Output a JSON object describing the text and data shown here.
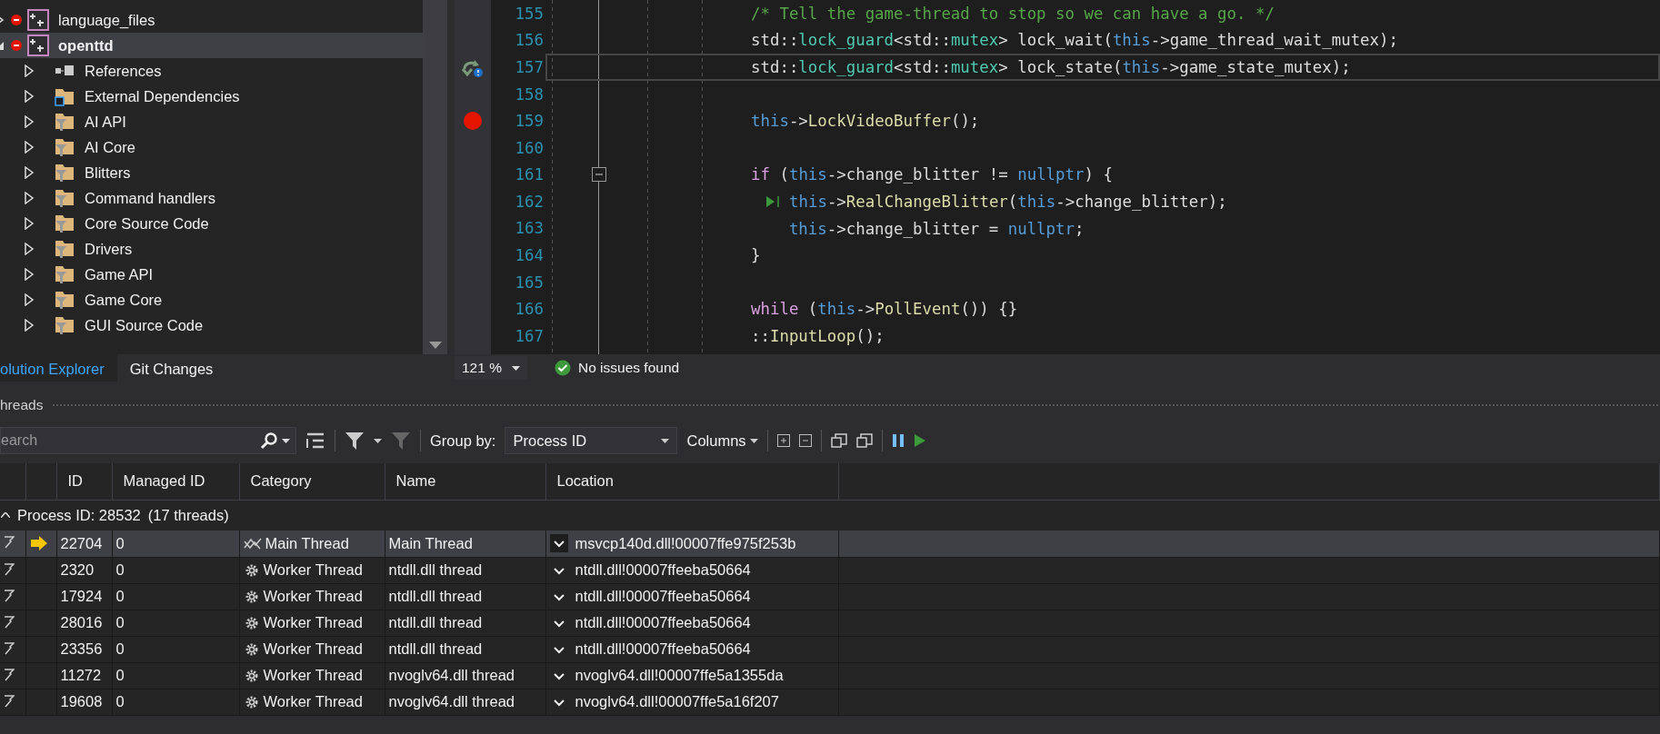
{
  "solution_explorer": {
    "tree": [
      {
        "label": "language_files",
        "kind": "project",
        "startup": false,
        "excluded": true,
        "expanded": false,
        "selected": false
      },
      {
        "label": "openttd",
        "kind": "project",
        "startup": true,
        "excluded": true,
        "expanded": true,
        "selected": true,
        "children": [
          {
            "label": "References",
            "kind": "references",
            "expanded": false,
            "selected": false
          },
          {
            "label": "External Dependencies",
            "kind": "external",
            "expanded": false,
            "selected": false
          },
          {
            "label": "AI API",
            "kind": "filter",
            "expanded": false,
            "selected": false
          },
          {
            "label": "AI Core",
            "kind": "filter",
            "expanded": false,
            "selected": false
          },
          {
            "label": "Blitters",
            "kind": "filter",
            "expanded": false,
            "selected": false
          },
          {
            "label": "Command handlers",
            "kind": "filter",
            "expanded": false,
            "selected": false
          },
          {
            "label": "Core Source Code",
            "kind": "filter",
            "expanded": false,
            "selected": false
          },
          {
            "label": "Drivers",
            "kind": "filter",
            "expanded": false,
            "selected": false
          },
          {
            "label": "Game API",
            "kind": "filter",
            "expanded": false,
            "selected": false
          },
          {
            "label": "Game Core",
            "kind": "filter",
            "expanded": false,
            "selected": false
          },
          {
            "label": "GUI Source Code",
            "kind": "filter",
            "expanded": false,
            "selected": false
          }
        ]
      }
    ],
    "tabs": [
      {
        "label": "olution Explorer",
        "selected": true
      },
      {
        "label": "Git Changes",
        "selected": false
      }
    ]
  },
  "editor": {
    "lines": [
      {
        "number": "155",
        "breakpoint": false,
        "step_marker": false,
        "current": false,
        "foldable": false,
        "run_to_click": false,
        "tokens": [
          {
            "kind": "comment",
            "text": "/* Tell the game-thread to stop so we can have a go. */"
          }
        ]
      },
      {
        "number": "156",
        "breakpoint": false,
        "step_marker": false,
        "current": false,
        "foldable": false,
        "run_to_click": false,
        "tokens": [
          {
            "kind": "plain",
            "text": "std::"
          },
          {
            "kind": "type",
            "text": "lock_guard"
          },
          {
            "kind": "plain",
            "text": "<std::"
          },
          {
            "kind": "type",
            "text": "mutex"
          },
          {
            "kind": "plain",
            "text": "> lock_wait("
          },
          {
            "kind": "keyword",
            "text": "this"
          },
          {
            "kind": "plain",
            "text": "->game_thread_wait_mutex);"
          }
        ]
      },
      {
        "number": "157",
        "breakpoint": false,
        "step_marker": true,
        "current": true,
        "foldable": false,
        "run_to_click": false,
        "tokens": [
          {
            "kind": "plain",
            "text": "std::"
          },
          {
            "kind": "type",
            "text": "lock_guard"
          },
          {
            "kind": "plain",
            "text": "<std::"
          },
          {
            "kind": "type",
            "text": "mutex"
          },
          {
            "kind": "plain",
            "text": "> lock_state("
          },
          {
            "kind": "keyword",
            "text": "this"
          },
          {
            "kind": "plain",
            "text": "->game_state_mutex);"
          }
        ]
      },
      {
        "number": "158",
        "breakpoint": false,
        "step_marker": false,
        "current": false,
        "foldable": false,
        "run_to_click": false
      },
      {
        "number": "159",
        "breakpoint": true,
        "step_marker": false,
        "current": false,
        "foldable": false,
        "run_to_click": false,
        "tokens": [
          {
            "kind": "keyword",
            "text": "this"
          },
          {
            "kind": "plain",
            "text": "->"
          },
          {
            "kind": "function",
            "text": "LockVideoBuffer"
          },
          {
            "kind": "plain",
            "text": "();"
          }
        ]
      },
      {
        "number": "160",
        "breakpoint": false,
        "step_marker": false,
        "current": false,
        "foldable": false,
        "run_to_click": false
      },
      {
        "number": "161",
        "breakpoint": false,
        "step_marker": false,
        "current": false,
        "foldable": true,
        "run_to_click": false,
        "tokens": [
          {
            "kind": "control",
            "text": "if"
          },
          {
            "kind": "plain",
            "text": " ("
          },
          {
            "kind": "keyword",
            "text": "this"
          },
          {
            "kind": "plain",
            "text": "->change_blitter != "
          },
          {
            "kind": "keyword",
            "text": "nullptr"
          },
          {
            "kind": "plain",
            "text": ") {"
          }
        ]
      },
      {
        "number": "162",
        "breakpoint": false,
        "step_marker": false,
        "current": false,
        "foldable": false,
        "run_to_click": true,
        "tokens": [
          {
            "kind": "keyword",
            "text": "this"
          },
          {
            "kind": "plain",
            "text": "->"
          },
          {
            "kind": "function",
            "text": "RealChangeBlitter"
          },
          {
            "kind": "plain",
            "text": "("
          },
          {
            "kind": "keyword",
            "text": "this"
          },
          {
            "kind": "plain",
            "text": "->change_blitter);"
          }
        ]
      },
      {
        "number": "163",
        "breakpoint": false,
        "step_marker": false,
        "current": false,
        "foldable": false,
        "run_to_click": false,
        "tokens": [
          {
            "kind": "keyword",
            "text": "    this"
          },
          {
            "kind": "plain",
            "text": "->change_blitter = "
          },
          {
            "kind": "keyword",
            "text": "nullptr"
          },
          {
            "kind": "plain",
            "text": ";"
          }
        ]
      },
      {
        "number": "164",
        "breakpoint": false,
        "step_marker": false,
        "current": false,
        "foldable": false,
        "run_to_click": false,
        "tokens": [
          {
            "kind": "plain",
            "text": "}"
          }
        ]
      },
      {
        "number": "165",
        "breakpoint": false,
        "step_marker": false,
        "current": false,
        "foldable": false,
        "run_to_click": false
      },
      {
        "number": "166",
        "breakpoint": false,
        "step_marker": false,
        "current": false,
        "foldable": false,
        "run_to_click": false,
        "tokens": [
          {
            "kind": "control",
            "text": "while"
          },
          {
            "kind": "plain",
            "text": " ("
          },
          {
            "kind": "keyword",
            "text": "this"
          },
          {
            "kind": "plain",
            "text": "->"
          },
          {
            "kind": "function",
            "text": "PollEvent"
          },
          {
            "kind": "plain",
            "text": "()) {}"
          }
        ]
      },
      {
        "number": "167",
        "breakpoint": false,
        "step_marker": false,
        "current": false,
        "foldable": false,
        "run_to_click": false,
        "tokens": [
          {
            "kind": "plain",
            "text": "::"
          },
          {
            "kind": "function",
            "text": "InputLoop"
          },
          {
            "kind": "plain",
            "text": "();"
          }
        ]
      }
    ],
    "status": {
      "zoom": "121 %",
      "issues": "No issues found"
    }
  },
  "threads": {
    "title": "hreads",
    "toolbar": {
      "search_placeholder": "earch",
      "group_by_label": "Group by:",
      "group_by_value": "Process ID",
      "columns_label": "Columns"
    },
    "columns": [
      "ID",
      "Managed ID",
      "Category",
      "Name",
      "Location"
    ],
    "group": {
      "label": "Process ID: 28532",
      "count": "(17 threads)",
      "expanded": true
    },
    "rows": [
      {
        "id": "22704",
        "managed_id": "0",
        "kind": "main",
        "category": "Main Thread",
        "name": "Main Thread",
        "location": "msvcp140d.dll!00007ffe975f253b",
        "current": true,
        "selected": true
      },
      {
        "id": "2320",
        "managed_id": "0",
        "kind": "worker",
        "category": "Worker Thread",
        "name": "ntdll.dll thread",
        "location": "ntdll.dll!00007ffeeba50664",
        "current": false,
        "selected": false
      },
      {
        "id": "17924",
        "managed_id": "0",
        "kind": "worker",
        "category": "Worker Thread",
        "name": "ntdll.dll thread",
        "location": "ntdll.dll!00007ffeeba50664",
        "current": false,
        "selected": false
      },
      {
        "id": "28016",
        "managed_id": "0",
        "kind": "worker",
        "category": "Worker Thread",
        "name": "ntdll.dll thread",
        "location": "ntdll.dll!00007ffeeba50664",
        "current": false,
        "selected": false
      },
      {
        "id": "23356",
        "managed_id": "0",
        "kind": "worker",
        "category": "Worker Thread",
        "name": "ntdll.dll thread",
        "location": "ntdll.dll!00007ffeeba50664",
        "current": false,
        "selected": false
      },
      {
        "id": "11272",
        "managed_id": "0",
        "kind": "worker",
        "category": "Worker Thread",
        "name": "nvoglv64.dll thread",
        "location": "nvoglv64.dll!00007ffe5a1355da",
        "current": false,
        "selected": false
      },
      {
        "id": "19608",
        "managed_id": "0",
        "kind": "worker",
        "category": "Worker Thread",
        "name": "nvoglv64.dll thread",
        "location": "nvoglv64.dll!00007ffe5a16f207",
        "current": false,
        "selected": false
      }
    ]
  }
}
